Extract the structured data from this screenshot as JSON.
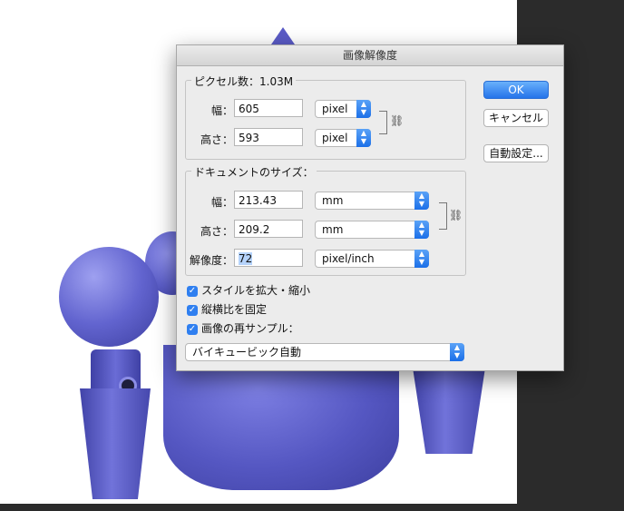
{
  "dialog": {
    "title": "画像解像度",
    "pixel_group": {
      "title": "ピクセル数：1.03M",
      "width_label": "幅：",
      "width_value": "605",
      "width_unit": "pixel",
      "height_label": "高さ：",
      "height_value": "593",
      "height_unit": "pixel"
    },
    "doc_group": {
      "title": "ドキュメントのサイズ：",
      "width_label": "幅：",
      "width_value": "213.43",
      "width_unit": "mm",
      "height_label": "高さ：",
      "height_value": "209.2",
      "height_unit": "mm",
      "resolution_label": "解像度：",
      "resolution_value": "72",
      "resolution_unit": "pixel/inch"
    },
    "options": {
      "scale_styles": "スタイルを拡大・縮小",
      "constrain_proportions": "縦横比を固定",
      "resample": "画像の再サンプル："
    },
    "resample_method": "バイキュービック自動",
    "buttons": {
      "ok": "OK",
      "cancel": "キャンセル",
      "auto": "自動設定..."
    }
  },
  "colors": {
    "accent": "#2f7ff0",
    "model": "#5a5bc6",
    "workspace": "#2b2b2b"
  }
}
